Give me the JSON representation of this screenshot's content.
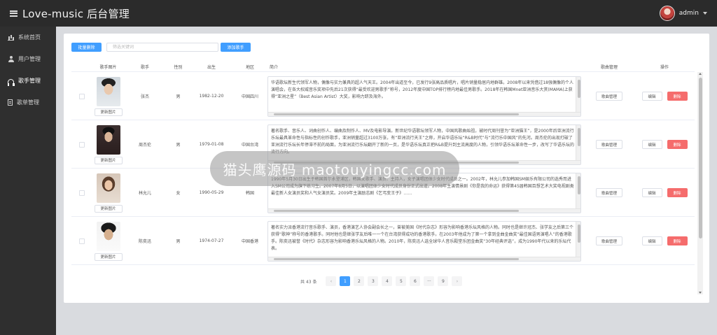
{
  "app": {
    "title": "Love-music 后台管理",
    "user": "admin"
  },
  "sidebar": {
    "items": [
      {
        "label": "系统首页",
        "icon": "bar-chart-icon"
      },
      {
        "label": "用户管理",
        "icon": "user-icon"
      },
      {
        "label": "歌手管理",
        "icon": "headphones-icon",
        "active": true
      },
      {
        "label": "歌单管理",
        "icon": "document-icon"
      }
    ]
  },
  "toolbar": {
    "batch_delete": "批量删除",
    "search_placeholder": "筛选关键词",
    "add_singer": "添加歌手"
  },
  "table": {
    "headers": [
      "歌手图片",
      "歌手",
      "性别",
      "出生",
      "地区",
      "简介",
      "歌曲管理",
      "操作"
    ],
    "update_image_label": "更新图片",
    "song_manage_label": "歌曲管理",
    "edit_label": "编辑",
    "delete_label": "删除",
    "rows": [
      {
        "name": "张杰",
        "sex": "男",
        "birth": "1982-12-20",
        "area": "中国四川",
        "intro": "华语歌坛新生代领军人物，偶像与实力兼具的超人气天王。2004年出道至今，已发行9张高品质唱片，唱片销量稳居内地群雄。2008年以来凭借过18强偶像的个人演唱会，在各大权威音乐奖项中先后21次获得“最受欢迎男歌手”称号，2012年度中国TOP排行榜内地最佳男歌手。2018年在韩国Mnet亚洲音乐大赏(MAMA)上获得“亚洲之星”（Best Asian Artist）大奖，影响力跻及海外。"
      },
      {
        "name": "周杰伦",
        "sex": "男",
        "birth": "1979-01-08",
        "area": "中国台湾",
        "intro": "著名歌手、音乐人、词曲创作人、编曲及制作人、MV及电影导演。新世纪华语歌坛领军人物，中国风歌曲始祖，被时代周刊誉为“亚洲猫王”，是2000年后亚洲流行乐坛最具革命性与指标性的创作歌手，亚洲销量超过3100万张，有“亚洲流行天王”之称，开启华语乐坛“R&B时代”与“流行乐中国风”的先河。周杰伦的出现打破了亚洲流行乐坛长年停滞不前的局面，为亚洲流行乐坛翻开了新的一页，是华语乐坛真正把R&B提升到主流高度的人物，引领华语乐坛革命性一步，改写了华语乐坛的流行方向。"
      },
      {
        "name": "林允儿",
        "sex": "女",
        "birth": "1990-05-29",
        "area": "韩国",
        "intro": "1990年5月30日出生于韩国首尔永登浦区，韩国女歌手、演员、主持人，女子演唱团体少女时代成员之一。2002年，林允儿参加韩国SM娱乐有限公司的选秀而进入SM公司成为旗下练习生。2007年8月5日，以演唱团体少女时代成员身份正式出道。2008年主演情景剧《你是我的命运》获得第45届韩国百想艺术大奖电视剧类最佳新人女演员奖和人气女演员奖。2009年主演励志剧《乞丐变王子》……"
      },
      {
        "name": "陈奕迅",
        "sex": "男",
        "birth": "1974-07-27",
        "area": "中国香港",
        "intro": "著名实力派香港流行音乐歌手、演员，香港演艺人协会副会长之一，曾被美国《时代杂志》形容为影响香港乐坛风格的人物。同时也是继许冠杰、张学友之后第三个获得“歌神”称号的香港歌手。同时他也是继张学友后唯一一个在台湾获得成功的香港歌手。在2003年他成为了第一个拿到金曲金曲奖“最佳国语男演唱人”的香港歌手。陈奕迅被誉《时代》杂志形容为影响香港乐坛风格的人物。2010年，陈奕迅人选全球华人音乐殿堂乐团金曲奖“30年经典评选”，成为1990年代以来的乐坛代表。"
      }
    ]
  },
  "pagination": {
    "total": "共 43 条",
    "pages": [
      "1",
      "2",
      "3",
      "4",
      "5",
      "6",
      "···",
      "9"
    ],
    "current": "1",
    "prev": "‹",
    "next": "›"
  },
  "watermark": "猫头鹰源码 maotouyingcc.com"
}
